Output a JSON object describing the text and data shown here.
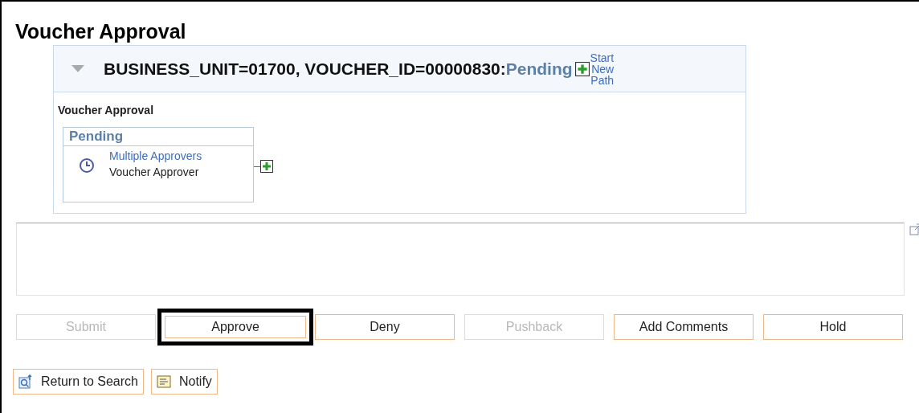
{
  "title": "Voucher Approval",
  "approval": {
    "expanded": true,
    "header": "BUSINESS_UNIT=01700, VOUCHER_ID=00000830:",
    "status": "Pending",
    "start_new_path": [
      "Start",
      "New",
      "Path"
    ],
    "section": "Voucher Approval",
    "stage": {
      "status": "Pending",
      "link": "Multiple Approvers",
      "role": "Voucher Approver"
    }
  },
  "actions": [
    {
      "label": "Submit",
      "disabled": true,
      "highlighted": false
    },
    {
      "label": "Approve",
      "disabled": false,
      "highlighted": true
    },
    {
      "label": "Deny",
      "disabled": false,
      "highlighted": false
    },
    {
      "label": "Pushback",
      "disabled": true,
      "highlighted": false
    },
    {
      "label": "Add Comments",
      "disabled": false,
      "highlighted": false
    },
    {
      "label": "Hold",
      "disabled": false,
      "highlighted": false
    }
  ],
  "footer": [
    {
      "kind": "search",
      "label": "Return to Search"
    },
    {
      "kind": "notify",
      "label": "Notify"
    }
  ]
}
